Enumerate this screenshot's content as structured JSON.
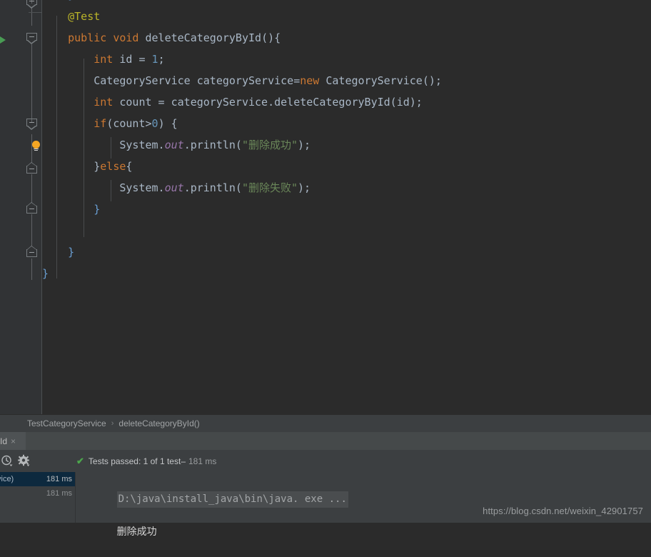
{
  "editor": {
    "code_lines": [
      {
        "indent": 1,
        "tokens": [
          {
            "t": "}",
            "c": "bb"
          }
        ]
      },
      {
        "indent": 1,
        "tokens": [
          {
            "t": "@Test",
            "c": "an"
          }
        ]
      },
      {
        "indent": 1,
        "tokens": [
          {
            "t": "public",
            "c": "k"
          },
          {
            "t": " ",
            "c": "id"
          },
          {
            "t": "void",
            "c": "k"
          },
          {
            "t": " ",
            "c": "id"
          },
          {
            "t": "deleteCategoryById",
            "c": "fn"
          },
          {
            "t": "(){",
            "c": "id"
          }
        ]
      },
      {
        "indent": 2,
        "tokens": [
          {
            "t": "int",
            "c": "k"
          },
          {
            "t": " id = ",
            "c": "id"
          },
          {
            "t": "1",
            "c": "num"
          },
          {
            "t": ";",
            "c": "id"
          }
        ]
      },
      {
        "indent": 2,
        "tokens": [
          {
            "t": "CategoryService categoryService=",
            "c": "id"
          },
          {
            "t": "new",
            "c": "k"
          },
          {
            "t": " CategoryService();",
            "c": "id"
          }
        ]
      },
      {
        "indent": 2,
        "tokens": [
          {
            "t": "int",
            "c": "k"
          },
          {
            "t": " count = categoryService.deleteCategoryById(id);",
            "c": "id"
          }
        ]
      },
      {
        "indent": 2,
        "tokens": [
          {
            "t": "if",
            "c": "k"
          },
          {
            "t": "(count>",
            "c": "id"
          },
          {
            "t": "0",
            "c": "num"
          },
          {
            "t": ") {",
            "c": "id"
          }
        ]
      },
      {
        "indent": 3,
        "tokens": [
          {
            "t": "System.",
            "c": "id"
          },
          {
            "t": "out",
            "c": "sf"
          },
          {
            "t": ".println(",
            "c": "id"
          },
          {
            "t": "\"删除成功\"",
            "c": "st"
          },
          {
            "t": ");",
            "c": "id"
          }
        ]
      },
      {
        "indent": 2,
        "tokens": [
          {
            "t": "}",
            "c": "id"
          },
          {
            "t": "else",
            "c": "k"
          },
          {
            "t": "{",
            "c": "id"
          }
        ]
      },
      {
        "indent": 3,
        "tokens": [
          {
            "t": "System.",
            "c": "id"
          },
          {
            "t": "out",
            "c": "sf"
          },
          {
            "t": ".println(",
            "c": "id"
          },
          {
            "t": "\"删除失败\"",
            "c": "st"
          },
          {
            "t": ");",
            "c": "id"
          }
        ]
      },
      {
        "indent": 2,
        "tokens": [
          {
            "t": "}",
            "c": "bb"
          }
        ]
      },
      {
        "indent": 0,
        "tokens": []
      },
      {
        "indent": 1,
        "tokens": [
          {
            "t": "}",
            "c": "bb"
          }
        ]
      },
      {
        "indent": 0,
        "tokens": [
          {
            "t": "}",
            "c": "bb"
          }
        ]
      }
    ],
    "run_arrow_tooltip": "Run test",
    "bulb_tooltip": "Show intention actions"
  },
  "breadcrumb": {
    "class_name": "TestCategoryService",
    "separator": "›",
    "method_name": "deleteCategoryById()"
  },
  "run_panel": {
    "tab": {
      "label": "yId",
      "close": "×"
    },
    "toolbar": {
      "history_icon": "history-clock-icon",
      "settings_icon": "gear-icon"
    },
    "status": {
      "check_glyph": "✔",
      "text": "Tests passed: 1 of 1 test",
      "dash": " – ",
      "duration": "181 ms"
    },
    "test_tree": [
      {
        "name": "vice)",
        "time": "181 ms",
        "selected": true
      },
      {
        "name": "",
        "time": "181 ms",
        "selected": false
      }
    ],
    "console": {
      "command_line": "D:\\java\\install_java\\bin\\java. exe ...",
      "output_line": "删除成功"
    }
  },
  "watermark": {
    "text": "https://blog.csdn.net/weixin_42901757"
  },
  "colors": {
    "editor_bg": "#2b2b2b",
    "gutter_bg": "#313335",
    "panel_bg": "#3c3f41",
    "keyword": "#cc7832",
    "string": "#6a8759",
    "number": "#6897bb",
    "annotation": "#bbb529",
    "identifier": "#a9b7c6",
    "static_field": "#9876aa",
    "success_green": "#499c54",
    "selection_blue": "#0d293e",
    "bulb_orange": "#f5a623"
  }
}
